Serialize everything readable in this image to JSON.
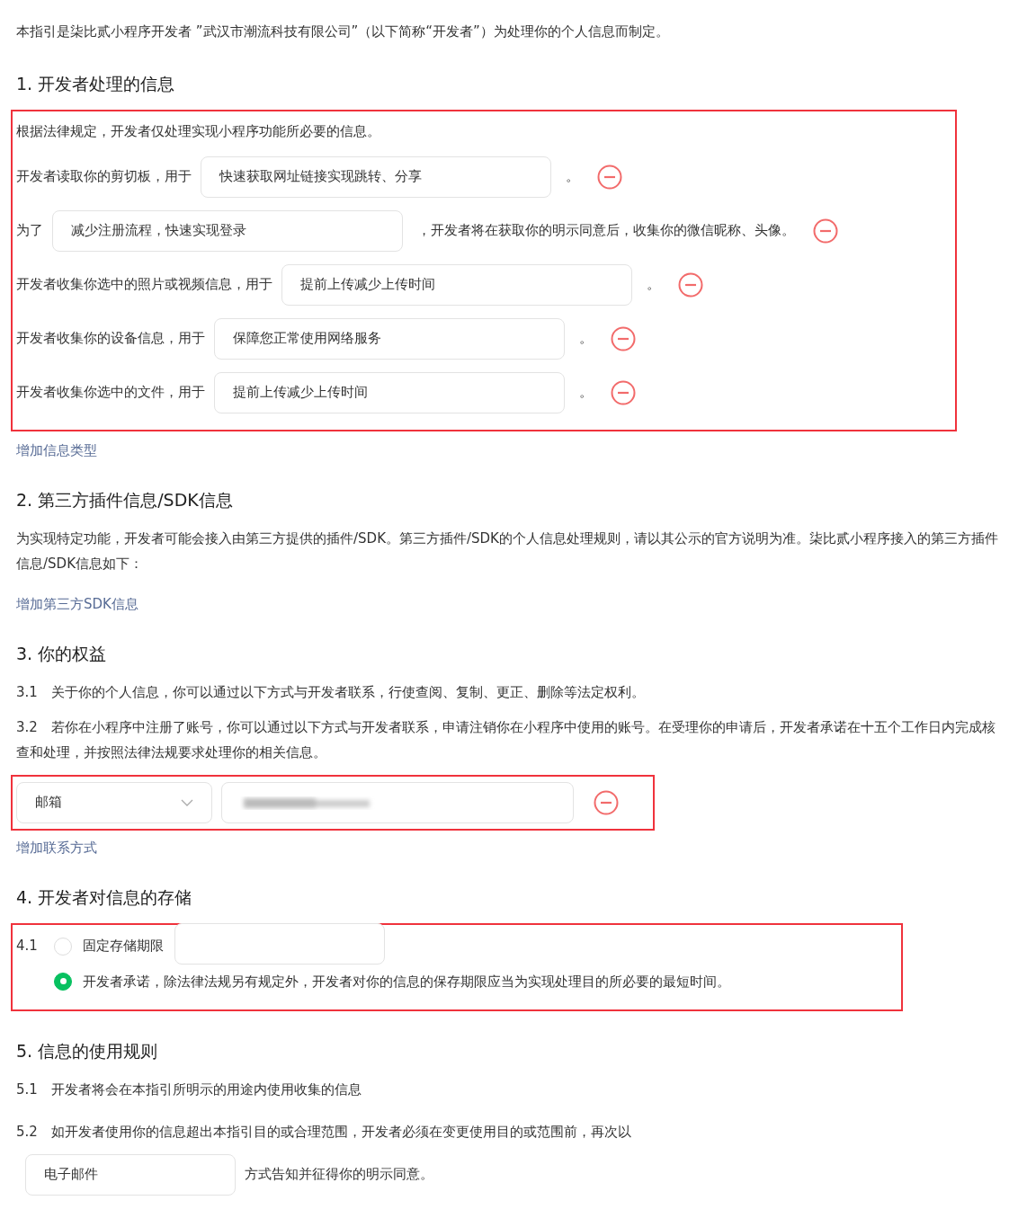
{
  "intro": "本指引是柒比贰小程序开发者 ”武汉市潮流科技有限公司”（以下简称“开发者”）为处理你的个人信息而制定。",
  "section1": {
    "title": "1.  开发者处理的信息",
    "highlighted": true,
    "items": [
      {
        "kind": "sentence",
        "text": "根据法律规定，开发者仅处理实现小程序功能所必要的信息。"
      },
      {
        "kind": "field",
        "before": "开发者读取你的剪切板，用于",
        "value": "快速获取网址链接实现跳转、分享",
        "after": "。"
      },
      {
        "kind": "field",
        "before": "为了",
        "value": "减少注册流程，快速实现登录",
        "after": "，开发者将在获取你的明示同意后，收集你的微信昵称、头像。"
      },
      {
        "kind": "field",
        "before": "开发者收集你选中的照片或视频信息，用于",
        "value": "提前上传减少上传时间",
        "after": "。"
      },
      {
        "kind": "field",
        "before": "开发者收集你的设备信息，用于",
        "value": "保障您正常使用网络服务",
        "after": "。"
      },
      {
        "kind": "field",
        "before": "开发者收集你选中的文件，用于",
        "value": "提前上传减少上传时间",
        "after": "。"
      }
    ],
    "add_link": "增加信息类型"
  },
  "section2": {
    "title": "2.  第三方插件信息/SDK信息",
    "text": "为实现特定功能，开发者可能会接入由第三方提供的插件/SDK。第三方插件/SDK的个人信息处理规则，请以其公示的官方说明为准。柒比贰小程序接入的第三方插件信息/SDK信息如下：",
    "add_link": "增加第三方SDK信息"
  },
  "section3": {
    "title": "3.  你的权益",
    "paragraphs": [
      {
        "number": "3.1",
        "text": "关于你的个人信息，你可以通过以下方式与开发者联系，行使查阅、复制、更正、删除等法定权利。"
      },
      {
        "number": "3.2",
        "text": "若你在小程序中注册了账号，你可以通过以下方式与开发者联系，申请注销你在小程序中使用的账号。在受理你的申请后，开发者承诺在十五个工作日内完成核查和处理，并按照法律法规要求处理你的相关信息。"
      }
    ],
    "contact": {
      "highlighted": true,
      "type": "邮箱",
      "redacted": true
    },
    "add_link": "增加联系方式"
  },
  "section4": {
    "title": "4.  开发者对信息的存储",
    "highlighted": true,
    "number": "4.1",
    "options": [
      {
        "kind": "with_field",
        "label": "固定存储期限",
        "selected": false
      },
      {
        "kind": "plain",
        "label": "开发者承诺，除法律法规另有规定外，开发者对你的信息的保存期限应当为实现处理目的所必要的最短时间。",
        "selected": true
      }
    ]
  },
  "section5": {
    "title": "5.  信息的使用规则",
    "paragraphs": [
      {
        "number": "5.1",
        "text": "开发者将会在本指引所明示的用途内使用收集的信息"
      },
      {
        "number": "5.2",
        "text": "如开发者使用你的信息超出本指引目的或合理范围，开发者必须在变更使用目的或范围前，再次以"
      }
    ],
    "method_value": "电子邮件",
    "method_after": "方式告知并征得你的明示同意。"
  }
}
